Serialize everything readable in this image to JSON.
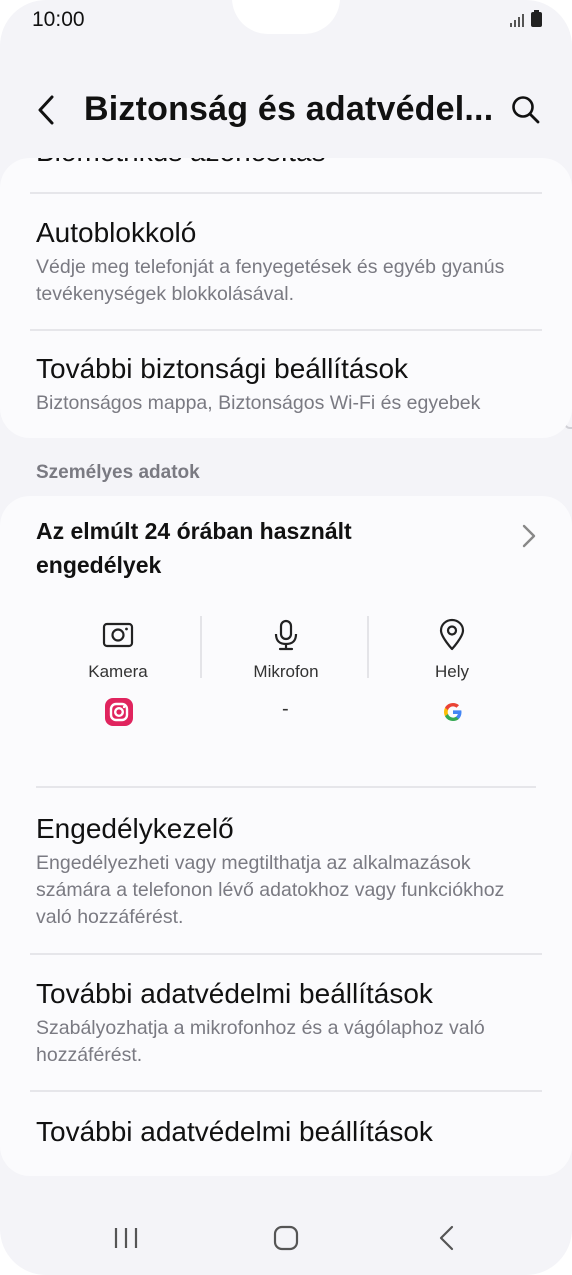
{
  "status_bar": {
    "time": "10:00"
  },
  "app_bar": {
    "title": "Biztonság és adatvédel..."
  },
  "card1": {
    "cut_off_text": "Biometrikus azonosítás",
    "items": [
      {
        "title": "Autoblokkoló",
        "subtitle": "Védje meg telefonját a fenyegetések és egyéb gyanús tevékenységek blokkolásával."
      },
      {
        "title": "További biztonsági beállítások",
        "subtitle": "Biztonságos mappa, Biztonságos Wi-Fi és egyebek"
      }
    ]
  },
  "section_header": "Személyes adatok",
  "permissions_card": {
    "title": "Az elmúlt 24 órában használt engedélyek",
    "columns": [
      {
        "label": "Kamera",
        "icon": "camera-icon",
        "app": "instagram-app-icon"
      },
      {
        "label": "Mikrofon",
        "icon": "microphone-icon",
        "app": "-"
      },
      {
        "label": "Hely",
        "icon": "location-icon",
        "app": "google-app-icon"
      }
    ],
    "items": [
      {
        "title": "Engedélykezelő",
        "subtitle": "Engedélyezheti vagy megtilthatja az alkalmazások számára a telefonon lévő adatokhoz vagy funkciókhoz való hozzáférést."
      },
      {
        "title": "További adatvédelmi beállítások",
        "subtitle": "Szabályozhatja a mikrofonhoz és a vágólaphoz való hozzáférést."
      },
      {
        "title": "További adatvédelmi beállítások"
      }
    ]
  },
  "colors": {
    "background": "#f4f4f8",
    "card": "#fbfbfd",
    "instagram": "#e0245e",
    "divider": "#e6e6ea"
  }
}
